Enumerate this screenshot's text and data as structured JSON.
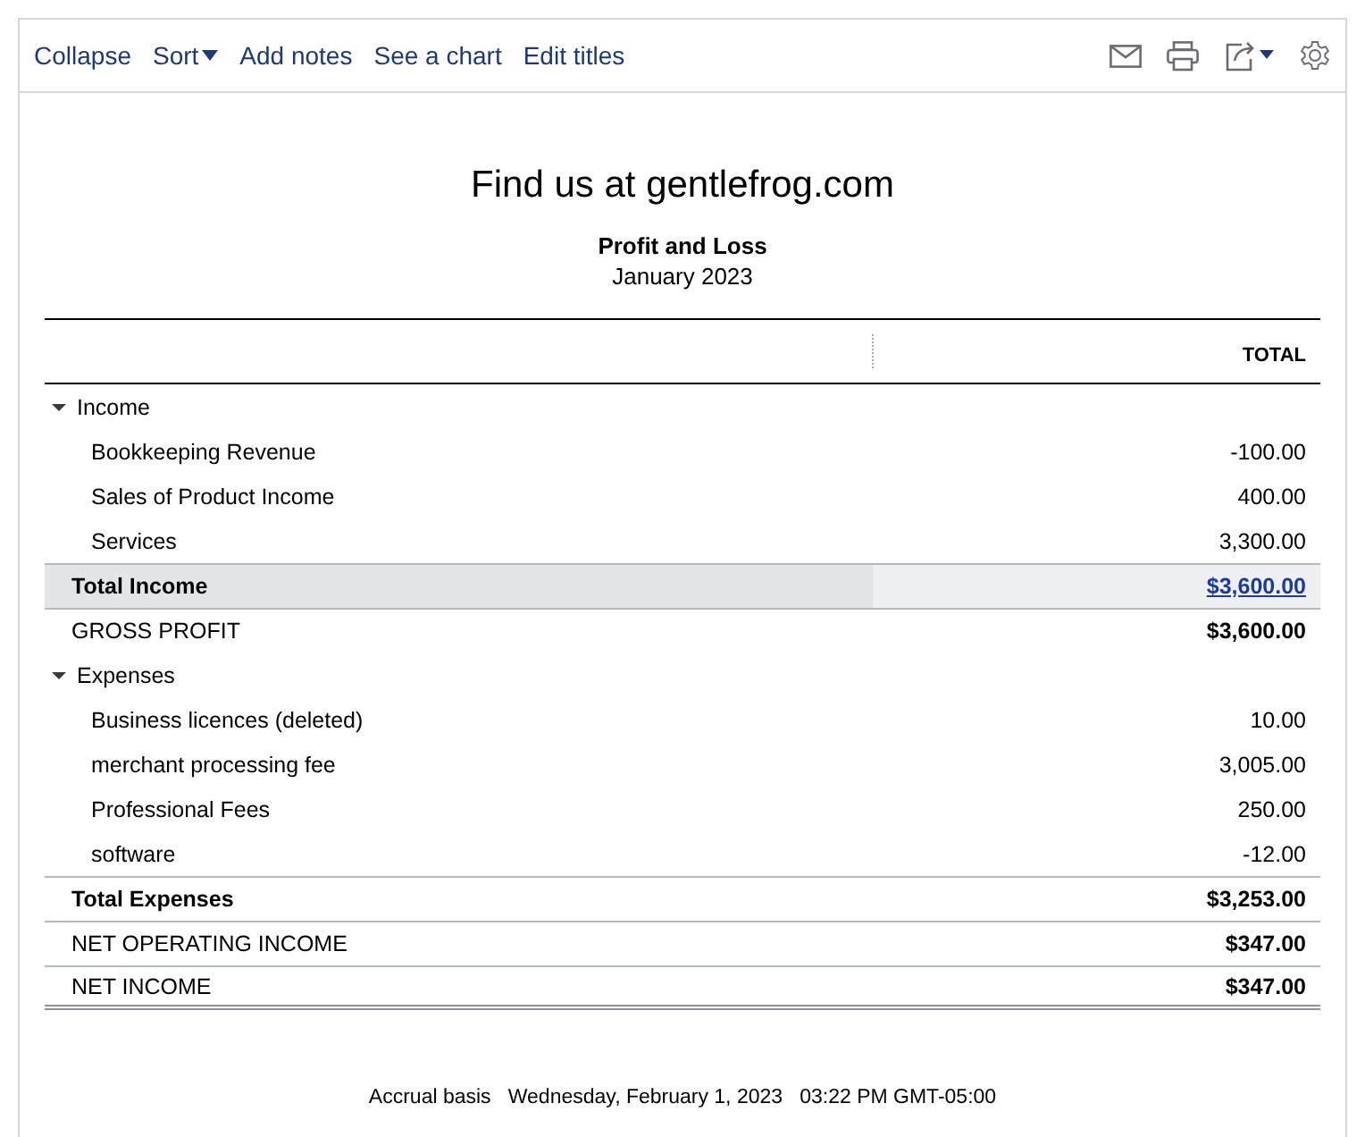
{
  "toolbar": {
    "actions": [
      {
        "label": "Collapse",
        "kind": "link"
      },
      {
        "label": "Sort",
        "kind": "dropdown"
      },
      {
        "label": "Add notes",
        "kind": "link"
      },
      {
        "label": "See a chart",
        "kind": "link"
      },
      {
        "label": "Edit titles",
        "kind": "link"
      }
    ]
  },
  "report": {
    "company": "Find us at gentlefrog.com",
    "title": "Profit and Loss",
    "period": "January 2023",
    "column_header": "TOTAL",
    "rows": [
      {
        "kind": "section",
        "label": "Income",
        "expanded": true
      },
      {
        "kind": "item",
        "label": "Bookkeeping Revenue",
        "value": "-100.00"
      },
      {
        "kind": "item",
        "label": "Sales of Product Income",
        "value": "400.00"
      },
      {
        "kind": "item",
        "label": "Services",
        "value": "3,300.00"
      },
      {
        "kind": "total",
        "label": "Total Income",
        "value": "$3,600.00",
        "highlighted": true
      },
      {
        "kind": "plain",
        "label": "GROSS PROFIT",
        "value": "$3,600.00",
        "highlighted": false
      },
      {
        "kind": "section",
        "label": "Expenses",
        "expanded": true
      },
      {
        "kind": "item",
        "label": "Business licences (deleted)",
        "value": "10.00"
      },
      {
        "kind": "item",
        "label": "merchant processing fee",
        "value": "3,005.00"
      },
      {
        "kind": "item",
        "label": "Professional Fees",
        "value": "250.00"
      },
      {
        "kind": "item",
        "label": "software",
        "value": "-12.00"
      },
      {
        "kind": "total",
        "label": "Total Expenses",
        "value": "$3,253.00",
        "highlighted": false
      },
      {
        "kind": "plain",
        "label": "NET OPERATING INCOME",
        "value": "$347.00",
        "highlighted": false
      },
      {
        "kind": "final",
        "label": "NET INCOME",
        "value": "$347.00",
        "highlighted": false
      }
    ],
    "footer": {
      "basis": "Accrual basis",
      "timestamp": "Wednesday, February 1, 2023   03:22 PM GMT-05:00"
    }
  }
}
